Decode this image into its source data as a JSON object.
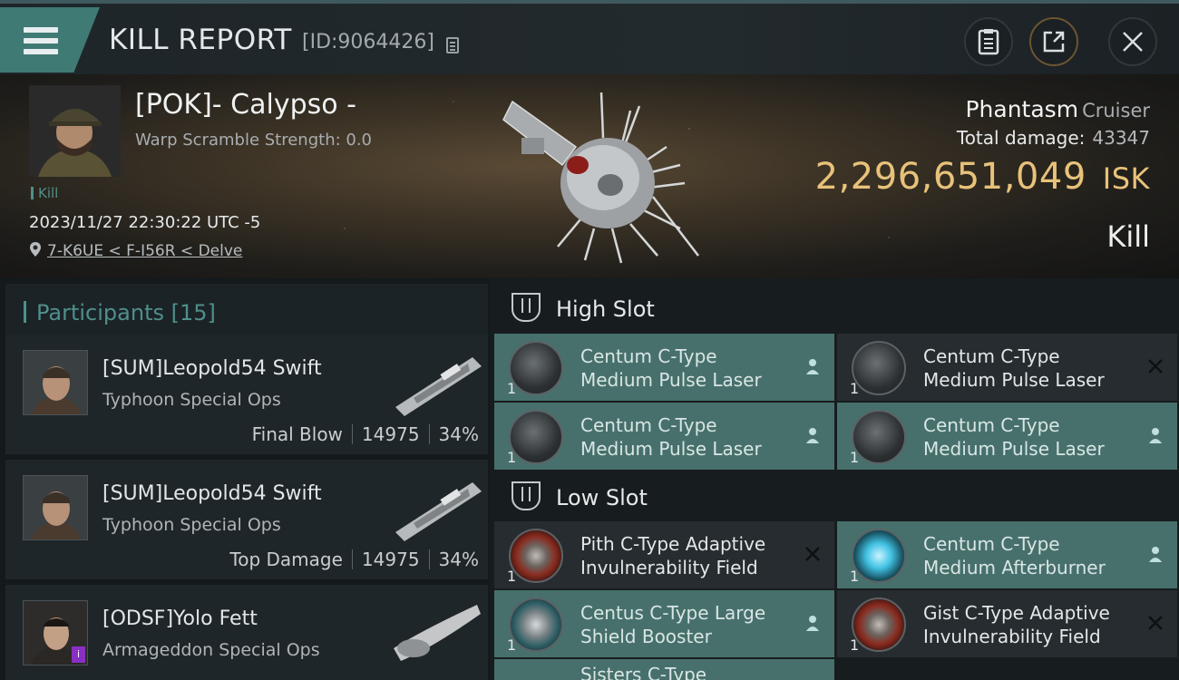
{
  "header": {
    "title": "KILL REPORT",
    "report_id": "[ID:9064426]"
  },
  "victim": {
    "name": "[POK]- Calypso -",
    "warp_scramble": "Warp Scramble Strength: 0.0",
    "tag": "Kill",
    "datetime": "2023/11/27 22:30:22 UTC -5",
    "location": "7-K6UE < F-I56R < Delve",
    "ship_name": "Phantasm",
    "ship_class": "Cruiser",
    "total_damage_label": "Total damage:",
    "total_damage": "43347",
    "isk_value": "2,296,651,049",
    "isk_unit": "ISK",
    "result": "Kill"
  },
  "participants": {
    "header": "Participants [15]",
    "items": [
      {
        "name": "[SUM]Leopold54 Swift",
        "ship": "Typhoon Special Ops",
        "role": "Final Blow",
        "damage": "14975",
        "percent": "34%"
      },
      {
        "name": "[SUM]Leopold54 Swift",
        "ship": "Typhoon Special Ops",
        "role": "Top Damage",
        "damage": "14975",
        "percent": "34%"
      },
      {
        "name": "[ODSF]Yolo Fett",
        "ship": "Armageddon Special Ops",
        "badge": "i"
      }
    ]
  },
  "fitting": {
    "high_slot_title": "High Slot",
    "low_slot_title": "Low Slot",
    "high_slot": [
      {
        "line1": "Centum C-Type",
        "line2": "Medium Pulse Laser",
        "qty": "1",
        "status": "dropped"
      },
      {
        "line1": "Centum C-Type",
        "line2": "Medium Pulse Laser",
        "qty": "1",
        "status": "destroyed"
      },
      {
        "line1": "Centum C-Type",
        "line2": "Medium Pulse Laser",
        "qty": "1",
        "status": "dropped"
      },
      {
        "line1": "Centum C-Type",
        "line2": "Medium Pulse Laser",
        "qty": "1",
        "status": "dropped"
      }
    ],
    "low_slot": [
      {
        "line1": "Pith C-Type Adaptive",
        "line2": "Invulnerability Field",
        "qty": "1",
        "status": "destroyed"
      },
      {
        "line1": "Centum C-Type",
        "line2": "Medium Afterburner",
        "qty": "1",
        "status": "dropped"
      },
      {
        "line1": "Centus C-Type Large",
        "line2": "Shield Booster",
        "qty": "1",
        "status": "dropped"
      },
      {
        "line1": "Gist C-Type Adaptive",
        "line2": "Invulnerability Field",
        "qty": "1",
        "status": "destroyed"
      }
    ],
    "partial_label": "Sisters C-Type"
  },
  "colors": {
    "accent_teal": "#4f8f8a",
    "isk_gold": "#e8c27a",
    "module_active": "#47706c",
    "module_inactive": "#262c2f"
  },
  "icons": {
    "menu": "hamburger-icon",
    "copy": "copy-icon",
    "notes": "clipboard-icon",
    "share": "share-icon",
    "close": "close-icon",
    "location": "map-pin-icon",
    "slot": "slot-icon",
    "dropped": "person-icon",
    "destroyed": "x-icon"
  }
}
